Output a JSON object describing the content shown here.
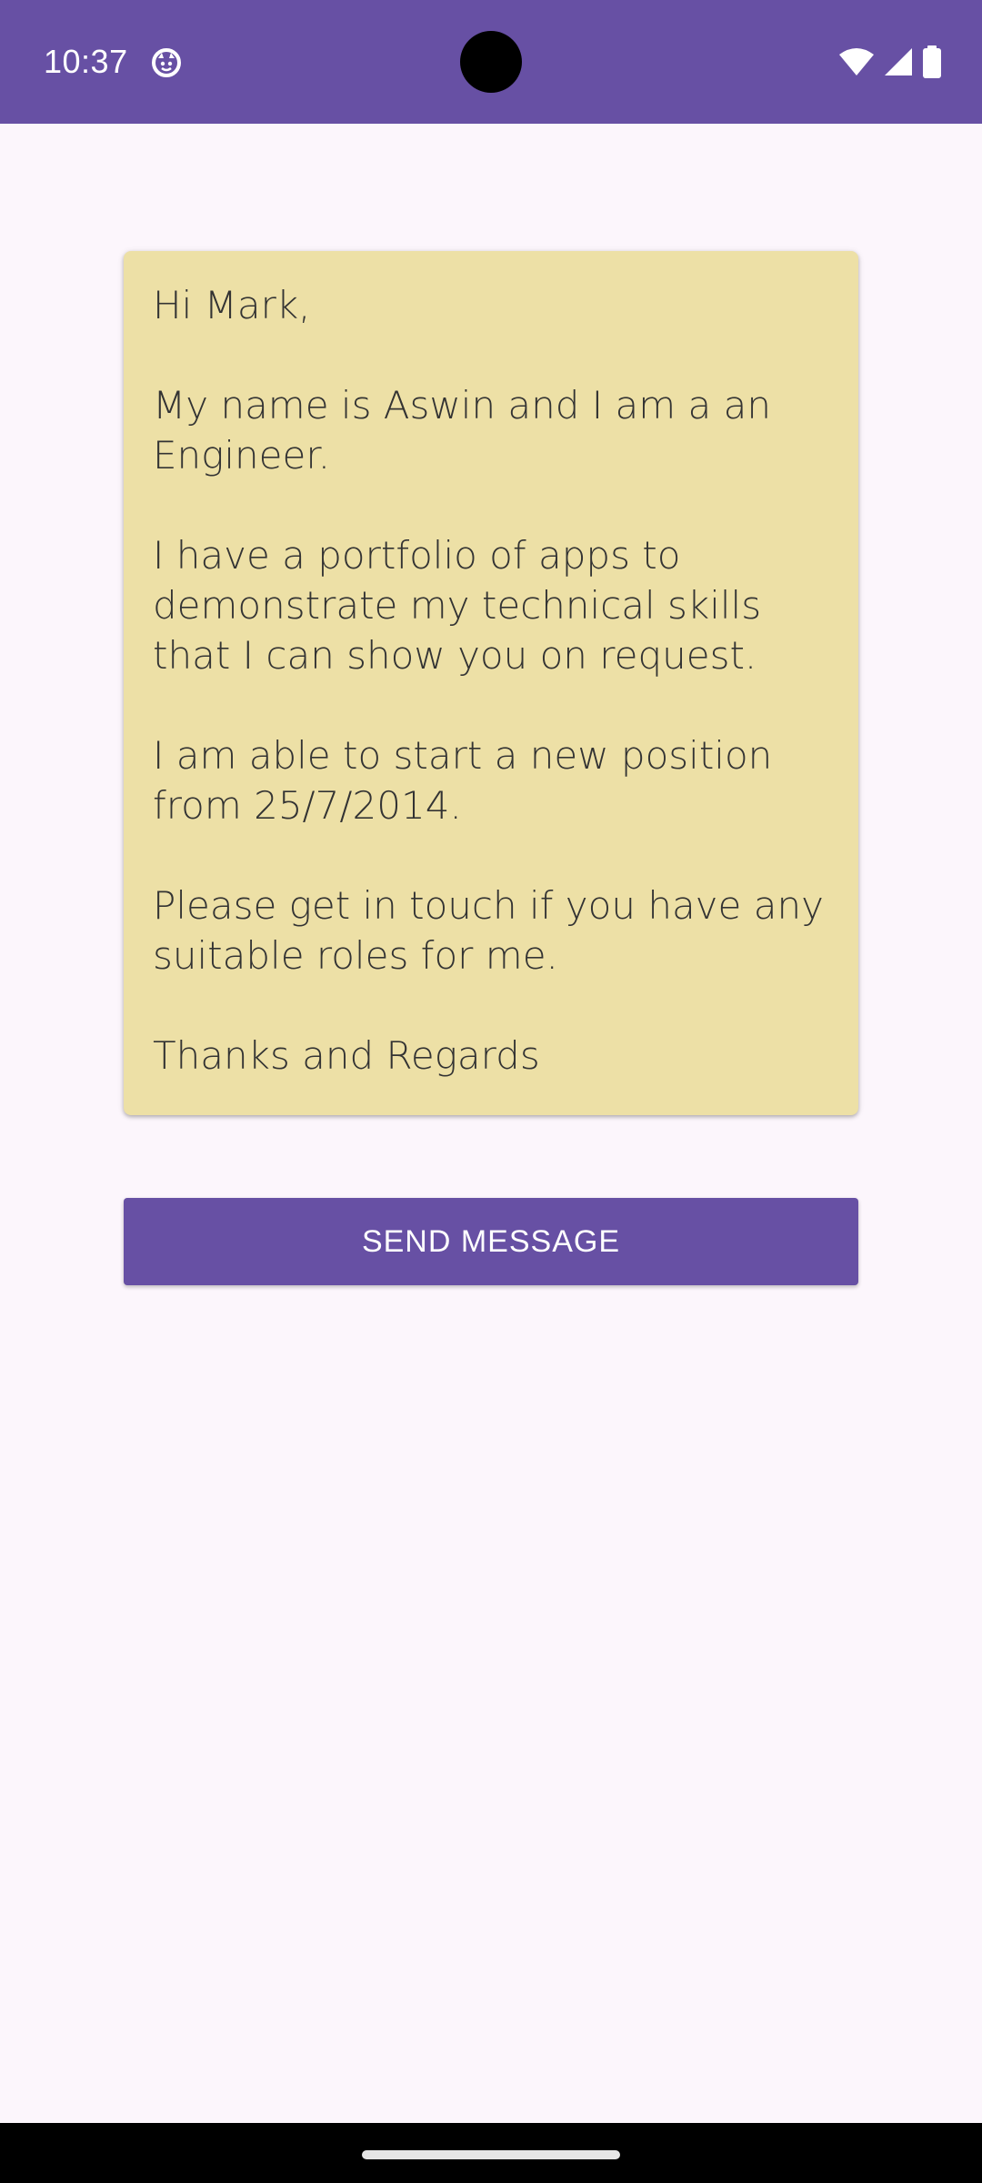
{
  "status_bar": {
    "time": "10:37",
    "icons": [
      "app-notification-icon",
      "wifi-icon",
      "cellular-signal-icon",
      "battery-icon"
    ]
  },
  "message": {
    "paragraphs": [
      "Hi Mark,",
      "My name is Aswin and I am a an Engineer.",
      "I have a portfolio of apps to demonstrate my technical skills that I can show you on request.",
      "I am able to start a new position from 25/7/2014.",
      "Please get in touch if you have any suitable roles for me.",
      "Thanks and Regards"
    ],
    "background_color": "#ede0a6"
  },
  "send_button": {
    "label": "SEND MESSAGE",
    "color": "#6750a4"
  },
  "colors": {
    "primary": "#6750a4",
    "background": "#fcf6fc"
  }
}
